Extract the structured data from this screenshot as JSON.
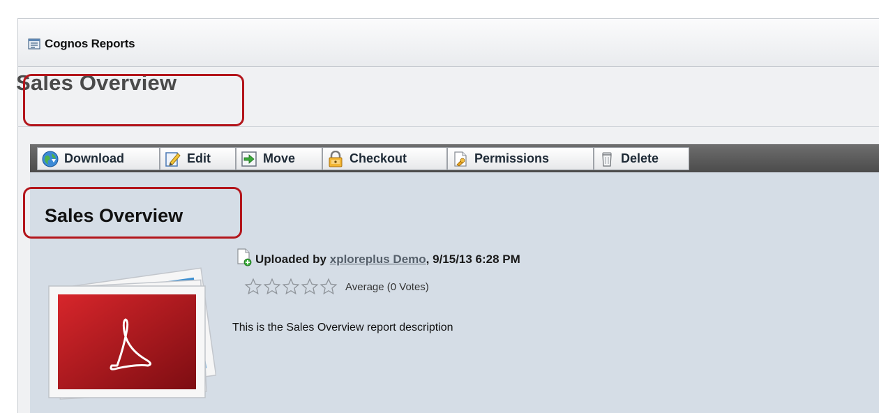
{
  "panel": {
    "title": "Cognos Reports",
    "icon": "report-folder-icon"
  },
  "page": {
    "title": "Sales Overview",
    "highlight_color": "#b3151b"
  },
  "toolbar": {
    "buttons": [
      {
        "label": "Download",
        "icon": "globe-download-icon"
      },
      {
        "label": "Edit",
        "icon": "pencil-edit-icon"
      },
      {
        "label": "Move",
        "icon": "arrow-right-icon"
      },
      {
        "label": "Checkout",
        "icon": "lock-icon"
      },
      {
        "label": "Permissions",
        "icon": "document-key-icon"
      },
      {
        "label": "Delete",
        "icon": "trash-icon"
      }
    ]
  },
  "document": {
    "title": "Sales Overview",
    "thumbnail_icon": "pdf-stack-icon",
    "uploaded_prefix": "Uploaded by",
    "uploader": "xploreplus Demo",
    "uploaded_suffix": ", 9/15/13 6:28 PM",
    "rating": {
      "stars_total": 5,
      "stars_filled": 0,
      "label": "Average (0 Votes)"
    },
    "description": "This is the Sales Overview report description"
  }
}
